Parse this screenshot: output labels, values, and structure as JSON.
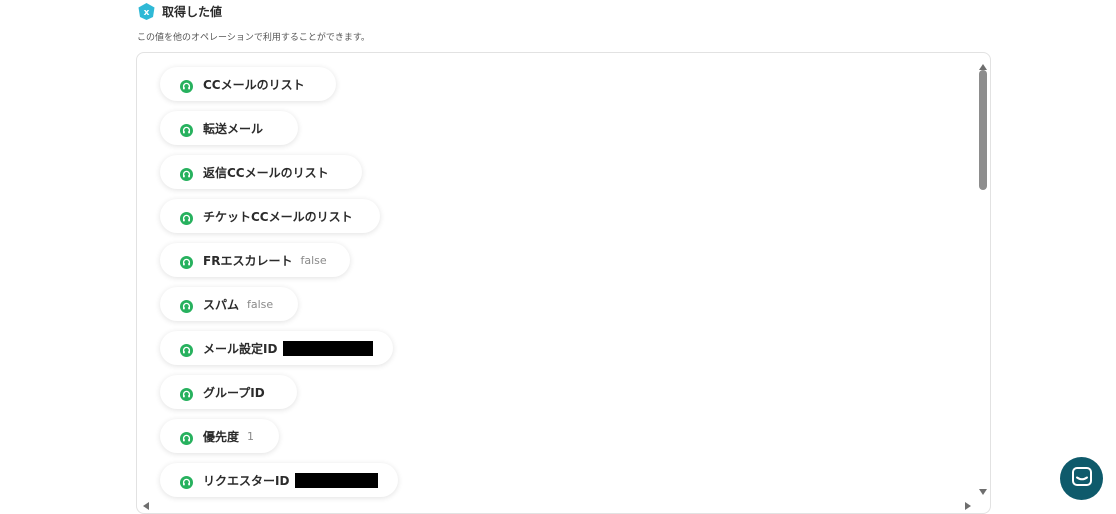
{
  "header": {
    "icon": "x-hexagon-icon",
    "title": "取得した値",
    "description": "この値を他のオペレーションで利用することができます。"
  },
  "colors": {
    "chip_icon": "#27b15e",
    "header_icon": "#2fb9d6",
    "chat_button": "#0e5a6b",
    "scroll_thumb": "#8d8d8d"
  },
  "items": [
    {
      "label": "CCメールのリスト",
      "value": ""
    },
    {
      "label": "転送メール",
      "value": ""
    },
    {
      "label": "返信CCメールのリスト",
      "value": ""
    },
    {
      "label": "チケットCCメールのリスト",
      "value": ""
    },
    {
      "label": "FRエスカレート",
      "value": "false"
    },
    {
      "label": "スパム",
      "value": "false"
    },
    {
      "label": "メール設定ID",
      "value": "",
      "redacted": true
    },
    {
      "label": "グループID",
      "value": ""
    },
    {
      "label": "優先度",
      "value": "1"
    },
    {
      "label": "リクエスターID",
      "value": "",
      "redacted": true
    }
  ],
  "chat": {
    "icon": "chat-bubble-icon"
  }
}
